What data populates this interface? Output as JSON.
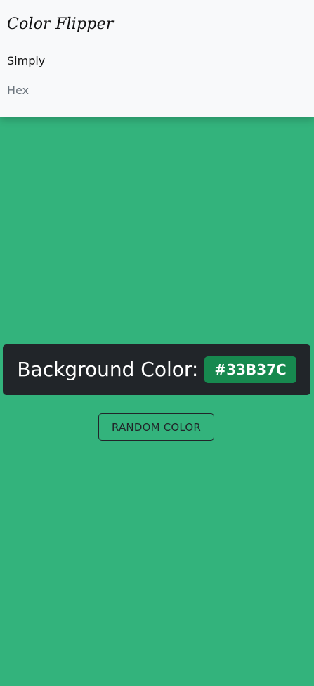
{
  "navbar": {
    "brand": "Color Flipper",
    "links": [
      {
        "label": "Simply"
      },
      {
        "label": "Hex"
      }
    ]
  },
  "main": {
    "background_color": "#33B37C",
    "label": "Background Color:",
    "hex_value": "#33B37C",
    "button_label": "RANDOM COLOR"
  },
  "colors": {
    "navbar_bg": "#f8f9fa",
    "banner_bg": "#212529",
    "badge_bg": "#17894f"
  }
}
